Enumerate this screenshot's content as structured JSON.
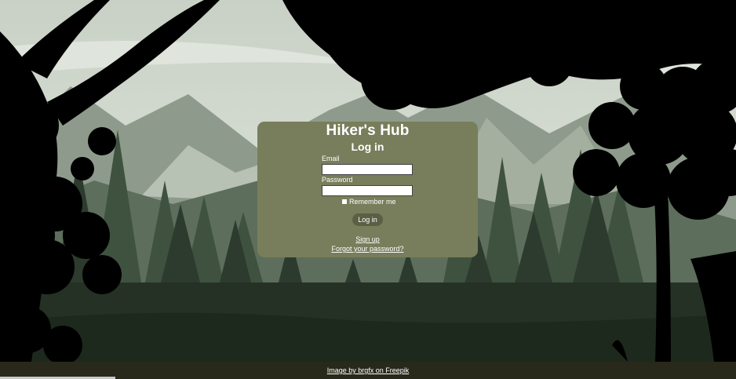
{
  "app": {
    "title": "Hiker's Hub"
  },
  "login": {
    "heading": "Log in",
    "email_label": "Email",
    "email_value": "",
    "password_label": "Password",
    "password_value": "",
    "remember_label": "Remember me",
    "remember_checked": false,
    "submit_label": "Log in",
    "signup_link": "Sign up",
    "forgot_link": "Forgot your password?"
  },
  "footer": {
    "credit_link": "Image by brgfx on Freepik"
  },
  "colors": {
    "card_bg": "#787d5b",
    "button_bg": "#5b5f45",
    "footer_bg": "#28291b",
    "text": "#ffffff"
  }
}
